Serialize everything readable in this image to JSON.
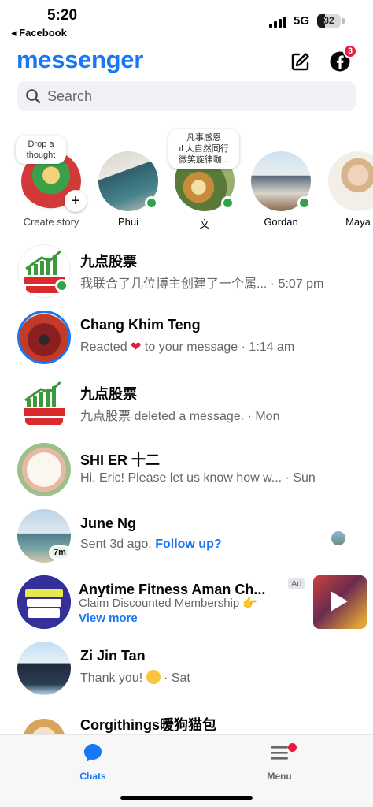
{
  "status_bar": {
    "time": "5:20",
    "back_app": "◂ Facebook",
    "network": "5G",
    "battery": "32",
    "battery_level": 0.32
  },
  "header": {
    "logo": "messenger",
    "compose_icon": "compose-icon",
    "facebook_icon": "facebook-icon",
    "notification_count": "3"
  },
  "search": {
    "placeholder": "Search"
  },
  "stories": [
    {
      "name": "Create story",
      "note": "Drop a thought"
    },
    {
      "name": "Phui",
      "online": true
    },
    {
      "name": "文",
      "online": true,
      "note_line1": "凡事感恩",
      "note_line2": "大自然同行",
      "note_line3": "微笑旋律咖..."
    },
    {
      "name": "Gordan",
      "online": true
    },
    {
      "name": "Maya"
    }
  ],
  "chats": [
    {
      "name": "九点股票",
      "preview": "我联合了几位博主创建了一个属...",
      "time": "· 5:07 pm",
      "online": true
    },
    {
      "name": "Chang Khim Teng",
      "preview_before": "Reacted",
      "preview_after": "to your message",
      "time": "· 1:14 am"
    },
    {
      "name": "九点股票",
      "preview": "九点股票  deleted a message.",
      "time": "· Mon"
    },
    {
      "name": "SHI ER 十二",
      "preview": "Hi, Eric! Please let us know how w...",
      "time": "· Sun"
    },
    {
      "name": "June Ng",
      "preview": "Sent 3d ago.",
      "follow_up": "Follow up?",
      "active_ago": "7m"
    },
    {
      "name": "Anytime Fitness Aman Ch...",
      "ad_label": "Ad",
      "preview": "Claim Discounted Membership",
      "view_more": "View more"
    },
    {
      "name": "Zi Jin Tan",
      "preview": "Thank you!",
      "time": "· Sat"
    },
    {
      "name": "Corgithings暖狗猫包"
    }
  ],
  "tabbar": {
    "chats": "Chats",
    "menu": "Menu"
  },
  "colors": {
    "brand": "#1877f2",
    "online": "#31a24c",
    "badge": "#e41e3f"
  }
}
